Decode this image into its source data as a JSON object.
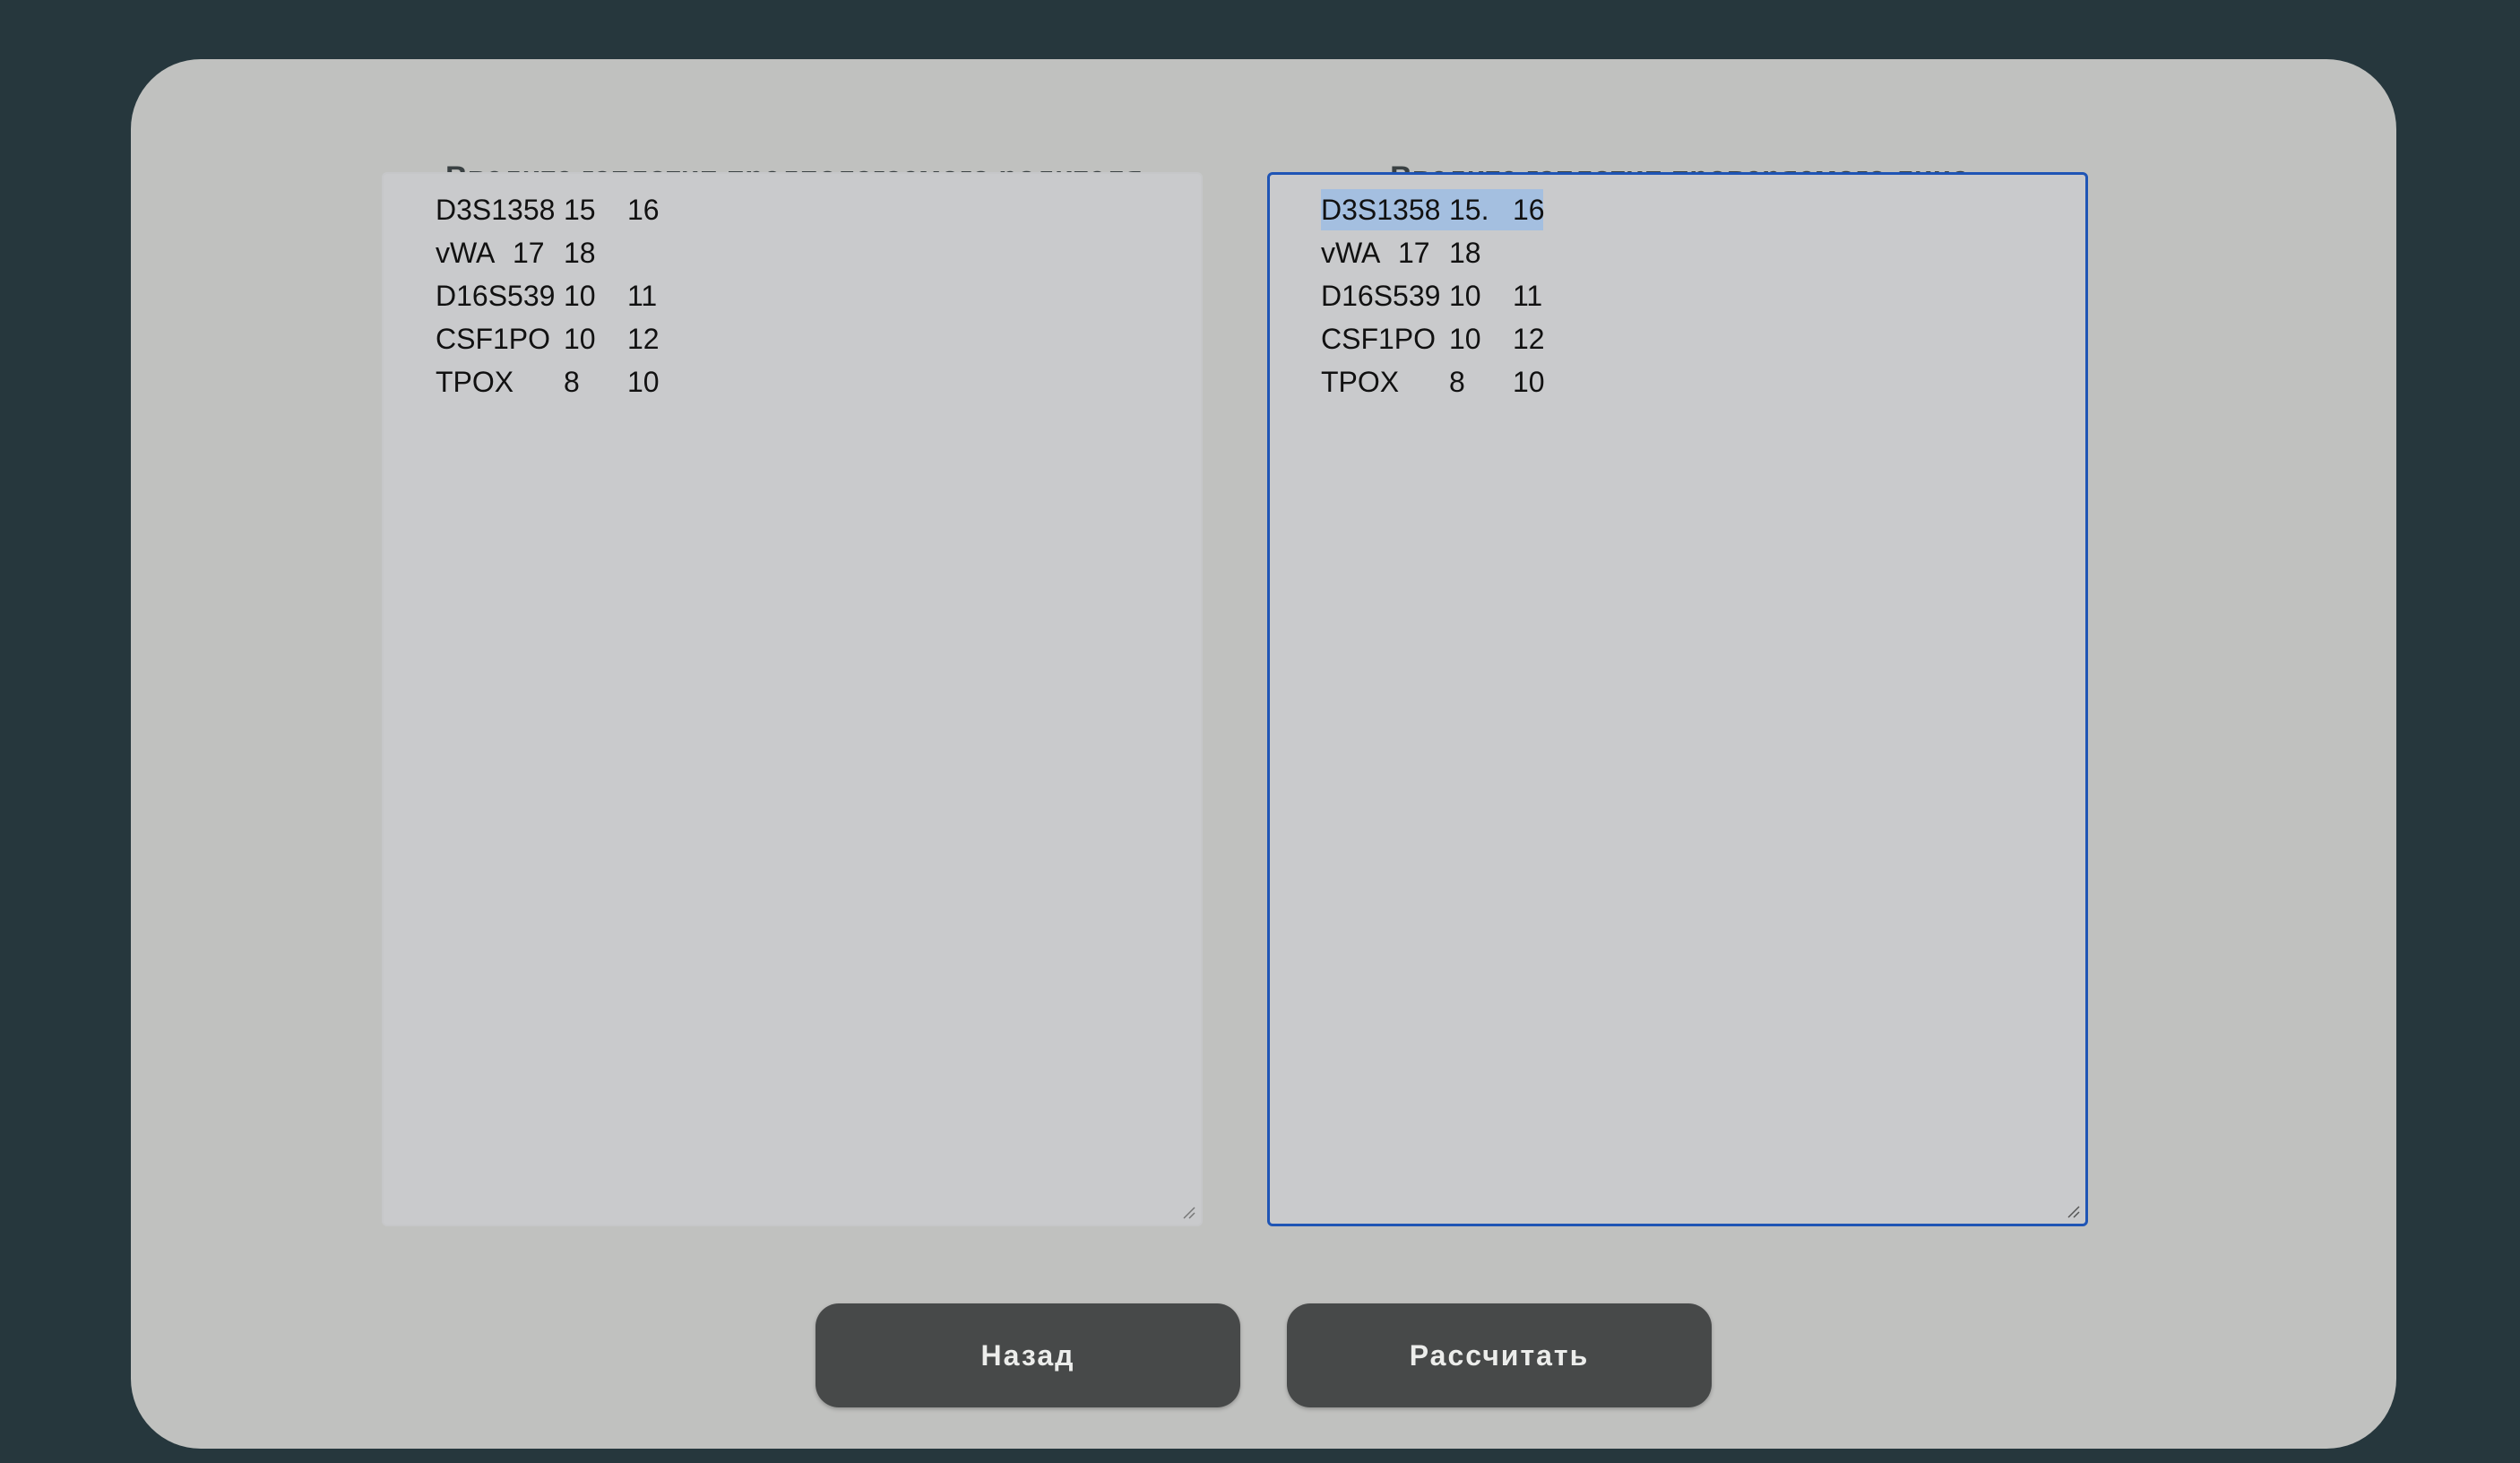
{
  "form": {
    "parent_title": "Введите гаплотип предполагаемого родителя",
    "subject_title": "Введите гаплотип проверяемого лица"
  },
  "parent_haplotype": [
    {
      "locus": "D3S1358",
      "allele1": "15",
      "allele2": "16"
    },
    {
      "locus": "vWA",
      "allele1": "17",
      "allele2": "18"
    },
    {
      "locus": "D16S539",
      "allele1": "10",
      "allele2": "11"
    },
    {
      "locus": "CSF1PO",
      "allele1": "10",
      "allele2": "12"
    },
    {
      "locus": "TPOX",
      "allele1": "8",
      "allele2": "10"
    }
  ],
  "subject_haplotype": [
    {
      "locus": "D3S1358",
      "allele1": "15.",
      "allele2": "16"
    },
    {
      "locus": "vWA",
      "allele1": "17",
      "allele2": "18"
    },
    {
      "locus": "D16S539",
      "allele1": "10",
      "allele2": "11"
    },
    {
      "locus": "CSF1PO",
      "allele1": "10",
      "allele2": "12"
    },
    {
      "locus": "TPOX",
      "allele1": "8",
      "allele2": "10"
    }
  ],
  "buttons": {
    "back": "Назад",
    "calculate": "Рассчитать"
  },
  "colors": {
    "background": "#26373d",
    "card": "#c0c1bf",
    "button": "#474949",
    "focus_border": "#1f55b5",
    "selection": "#a4bfe0"
  }
}
